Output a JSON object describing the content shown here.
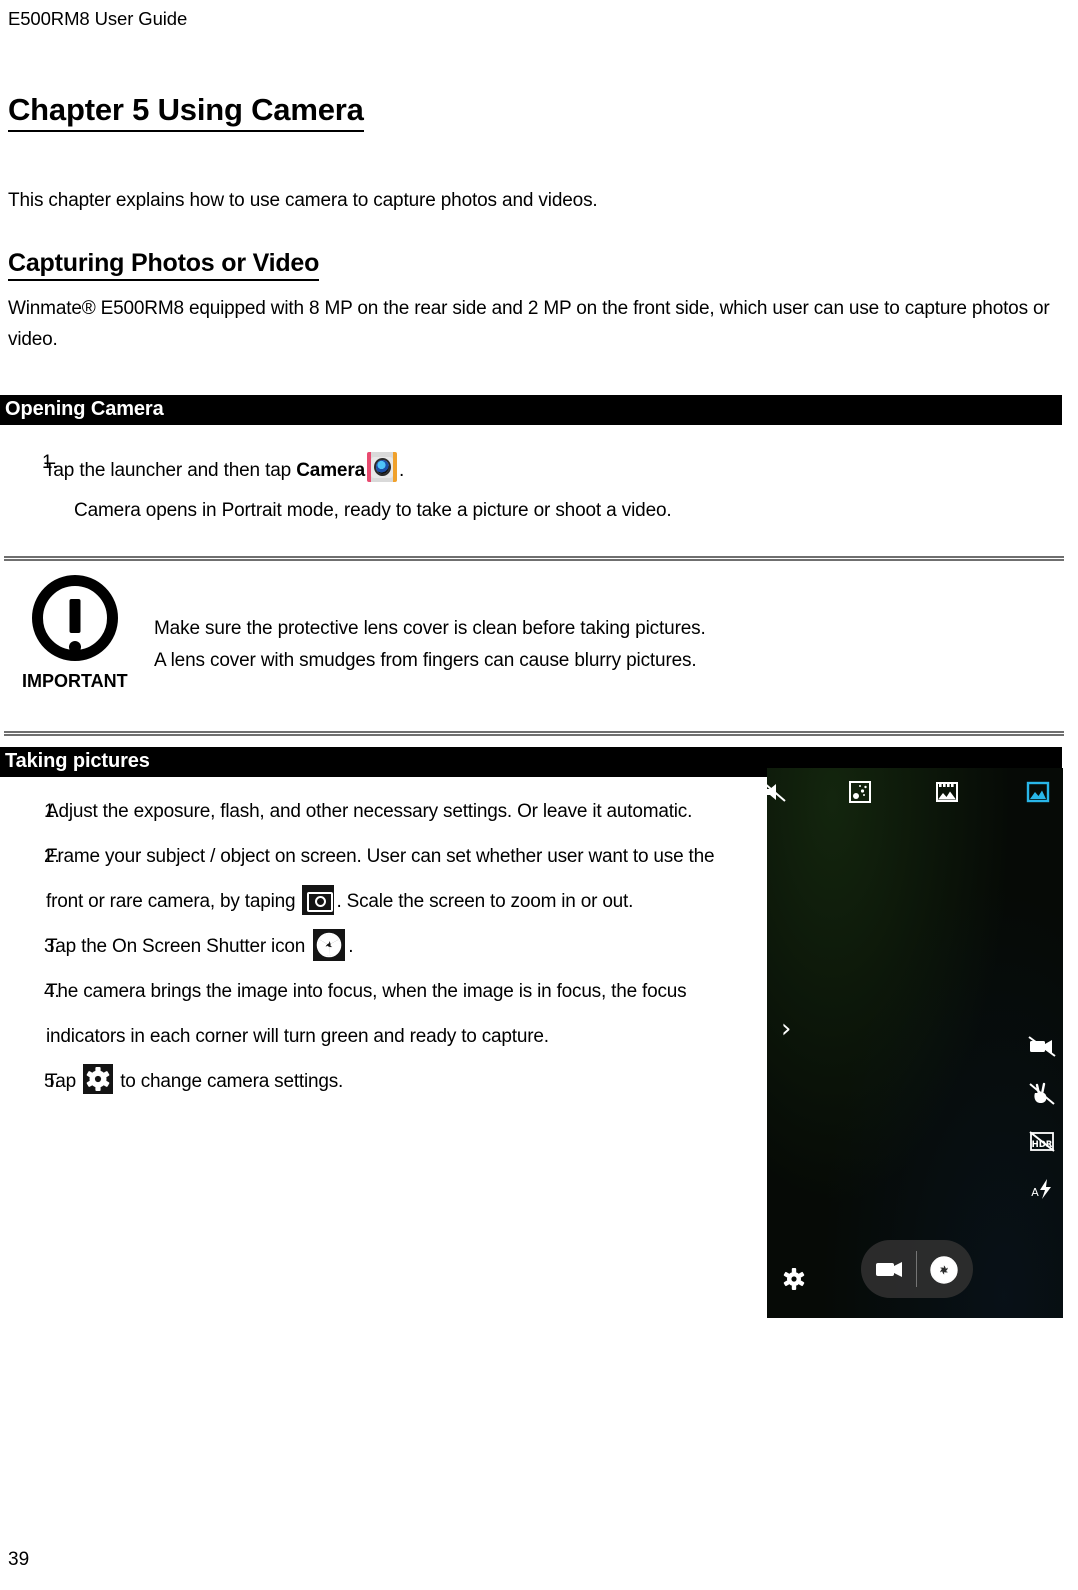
{
  "document": {
    "running_header": "E500RM8 User Guide",
    "page_number": "39"
  },
  "chapter": {
    "title": "Chapter 5 Using Camera",
    "intro": "This chapter explains how to use camera to capture photos and videos."
  },
  "section": {
    "title": "Capturing Photos or Video",
    "paragraph": "Winmate® E500RM8 equipped with 8 MP on the rear side and 2 MP on the front side, which user can use to capture photos or video."
  },
  "opening_camera": {
    "band_label": "Opening Camera",
    "steps": [
      {
        "number": "1.",
        "text_before": "Tap the launcher and then tap ",
        "bold_word": "Camera",
        "icon": "camera-app-icon",
        "text_after": "."
      }
    ],
    "note": "Camera opens in Portrait mode, ready to take a picture or shoot a video."
  },
  "important_callout": {
    "label": "IMPORTANT",
    "icon": "exclamation-circle-icon",
    "line1": "Make sure the protective lens cover is clean before taking pictures.",
    "line2": "A lens cover with smudges from fingers can cause blurry pictures."
  },
  "taking_pictures": {
    "band_label": "Taking pictures",
    "steps": [
      {
        "number": "1.",
        "text": "Adjust the exposure, flash, and other necessary settings. Or leave it automatic."
      },
      {
        "number": "2.",
        "text_before": "Frame your subject / object on screen. User can set whether user want to use the front or rare camera, by taping ",
        "icon": "camera-switch-icon",
        "text_after": ". Scale the screen to zoom in or out."
      },
      {
        "number": "3.",
        "text_before": "Tap the On Screen Shutter icon ",
        "icon": "shutter-icon",
        "text_after": "."
      },
      {
        "number": "4.",
        "text": "The camera brings the image into focus, when the image is in focus, the focus indicators in each corner will turn green and ready to capture."
      },
      {
        "number": "5.",
        "text_before": "Tap ",
        "icon": "settings-gear-icon",
        "text_after": " to change camera settings."
      }
    ]
  },
  "camera_screenshot": {
    "alt": "Android camera viewfinder in portrait mode",
    "top_icons": [
      {
        "name": "sound-shutter-icon",
        "color": "#ffffff"
      },
      {
        "name": "night-scene-icon",
        "color": "#ffffff"
      },
      {
        "name": "burst-film-icon",
        "color": "#ffffff"
      },
      {
        "name": "gallery-preview-icon",
        "color": "#29b6e8"
      }
    ],
    "expand_chevron": "›",
    "side_icons": [
      {
        "name": "video-off-icon"
      },
      {
        "name": "gesture-shot-off-icon"
      },
      {
        "name": "hdr-off-icon",
        "label": "HDR"
      },
      {
        "name": "auto-flash-icon",
        "label": "A"
      }
    ],
    "bottom": {
      "settings_icon": "settings-gear-icon",
      "video_button_icon": "video-record-icon",
      "shutter_button_icon": "shutter-aperture-icon"
    }
  },
  "colors": {
    "band_background": "#000000",
    "band_text": "#ffffff",
    "callout_rule": "#6f6f6f",
    "accent_blue": "#29b6e8"
  }
}
